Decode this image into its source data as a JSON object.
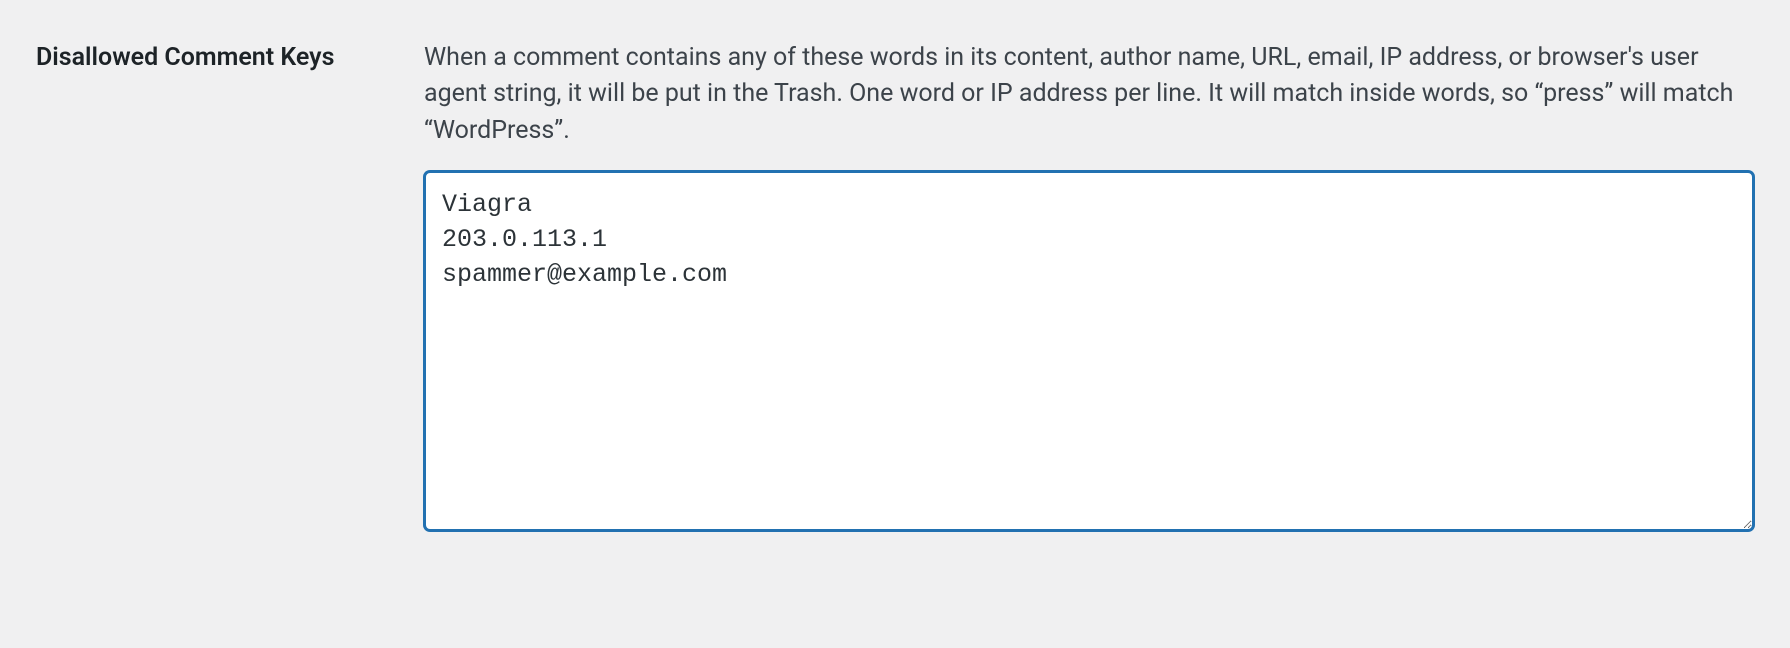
{
  "settings": {
    "disallowed_keys": {
      "label": "Disallowed Comment Keys",
      "description": "When a comment contains any of these words in its content, author name, URL, email, IP address, or browser's user agent string, it will be put in the Trash. One word or IP address per line. It will match inside words, so “press” will match “WordPress”.",
      "value": "Viagra\n203.0.113.1\nspammer@example.com"
    }
  }
}
